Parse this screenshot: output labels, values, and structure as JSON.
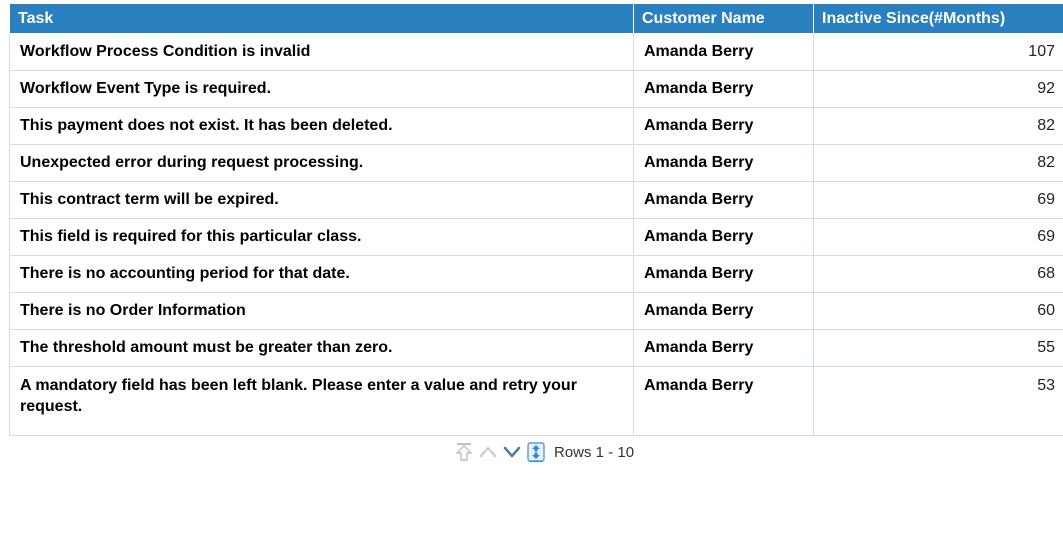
{
  "table": {
    "headers": {
      "task": "Task",
      "customer": "Customer Name",
      "inactive": "Inactive Since(#Months)"
    },
    "rows": [
      {
        "task": "Workflow Process Condition is invalid",
        "customer": "Amanda Berry",
        "inactive": "107"
      },
      {
        "task": "Workflow Event Type is required.",
        "customer": "Amanda Berry",
        "inactive": "92"
      },
      {
        "task": "This payment does not exist. It has been deleted.",
        "customer": "Amanda Berry",
        "inactive": "82"
      },
      {
        "task": "Unexpected error during request processing.",
        "customer": "Amanda Berry",
        "inactive": "82"
      },
      {
        "task": "This contract term will be expired.",
        "customer": "Amanda Berry",
        "inactive": "69"
      },
      {
        "task": "This field is required for this particular class.",
        "customer": "Amanda Berry",
        "inactive": "69"
      },
      {
        "task": "There is no accounting period for that date.",
        "customer": "Amanda Berry",
        "inactive": "68"
      },
      {
        "task": "There is no Order Information",
        "customer": "Amanda Berry",
        "inactive": "60"
      },
      {
        "task": "The threshold amount must be greater than zero.",
        "customer": "Amanda Berry",
        "inactive": "55"
      },
      {
        "task": "A mandatory field has been left blank. Please enter a value and retry your request.",
        "customer": "Amanda Berry",
        "inactive": "53"
      }
    ]
  },
  "pager": {
    "rows_label": "Rows 1 - 10",
    "icons": [
      "first-page-icon",
      "previous-page-icon",
      "next-page-icon",
      "all-rows-icon"
    ]
  },
  "colors": {
    "header_bg": "#2a7fbf",
    "header_text": "#ffffff",
    "grid_border": "#cfdde8"
  }
}
